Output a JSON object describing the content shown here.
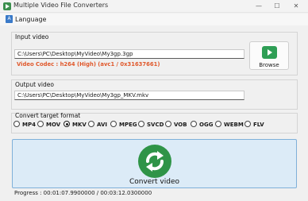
{
  "window": {
    "title": "Multiple Video File Converters",
    "controls": [
      "—",
      "☐",
      "✕"
    ]
  },
  "menu": {
    "language_label": "Language",
    "language_icon_text": "A"
  },
  "input": {
    "group_label": "Input video",
    "path": "C:\\Users\\PC\\Desktop\\MyVideo\\My3gp.3gp",
    "codec_text": "Video Codec : h264 (High) (avc1 / 0x31637661)",
    "browse_label": "Browse"
  },
  "output": {
    "group_label": "Output video",
    "path": "C:\\Users\\PC\\Desktop\\MyVideo\\My3gp_MKV.mkv"
  },
  "formats": {
    "group_label": "Convert target format",
    "options": [
      "MP4",
      "MOV",
      "MKV",
      "AVI",
      "MPEG",
      "SVCD",
      "VOB",
      "OGG",
      "WEBM",
      "FLV"
    ],
    "selected": "MKV"
  },
  "convert": {
    "label": "Convert video"
  },
  "status": {
    "progress_text": "Progress : 00:01:07.9900000 / 00:03:12.0300000"
  },
  "colors": {
    "accent_green": "#2f9447",
    "codec_orange": "#e0582b",
    "convert_bg": "#dcebf7"
  }
}
